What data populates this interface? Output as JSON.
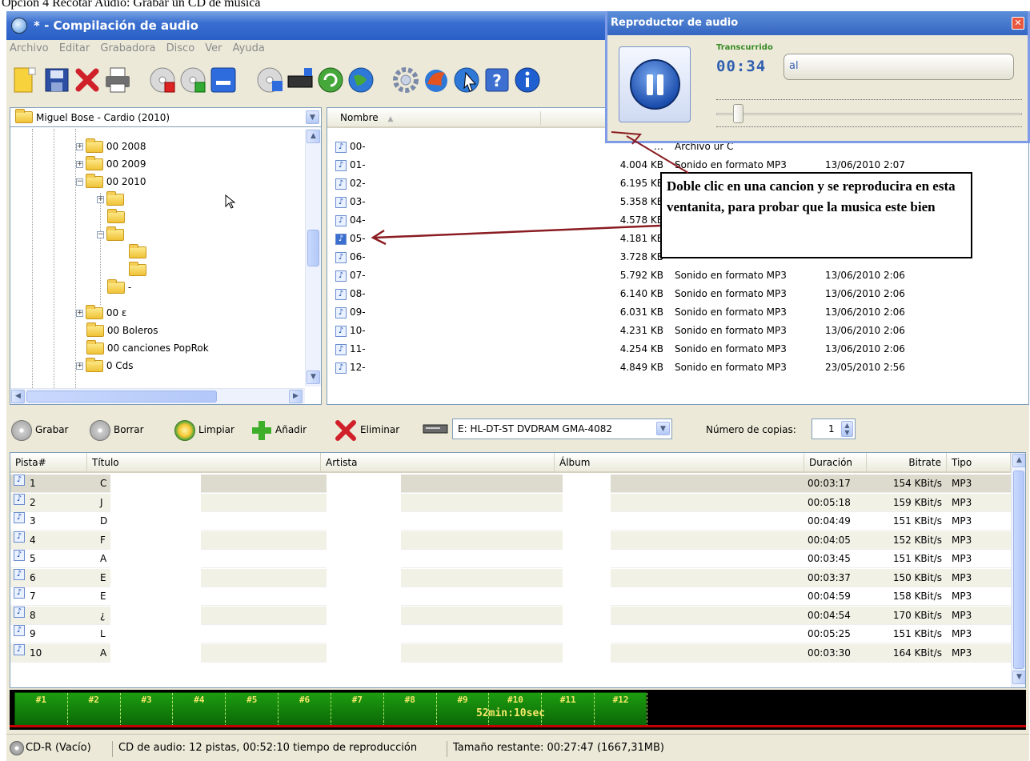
{
  "caption": "Opción 4 Recotar Audio: Grabar un CD de musica",
  "window": {
    "title": "* - Compilación de audio"
  },
  "menu": [
    "Archivo",
    "Editar",
    "Grabadora",
    "Disco",
    "Ver",
    "Ayuda"
  ],
  "folder_combo": "Miguel Bose - Cardio (2010)",
  "tree": {
    "items": [
      {
        "label": "00 2008",
        "expander": "+"
      },
      {
        "label": "00 2009",
        "expander": "+"
      },
      {
        "label": "00 2010",
        "expander": "−"
      },
      {
        "label": "",
        "expander": "+"
      },
      {
        "label": "",
        "expander": ""
      },
      {
        "label": "",
        "expander": "−"
      },
      {
        "label": "",
        "expander": ""
      },
      {
        "label": "",
        "expander": ""
      },
      {
        "label": "-",
        "expander": ""
      },
      {
        "label": "00 ε",
        "expander": "+"
      },
      {
        "label": "00 Boleros",
        "expander": ""
      },
      {
        "label": "00 canciones PopRok",
        "expander": ""
      },
      {
        "label": "0 Cds",
        "expander": "+"
      }
    ]
  },
  "files": {
    "header_name": "Nombre",
    "rows": [
      {
        "name": "00-",
        "size": "…",
        "type": "Archivo ur C",
        "date": ""
      },
      {
        "name": "01-",
        "size": "4.004 KB",
        "type": "Sonido en formato MP3",
        "date": "13/06/2010 2:07"
      },
      {
        "name": "02-",
        "size": "6.195 KB",
        "type": "",
        "date": ""
      },
      {
        "name": "03-",
        "size": "5.358 KB",
        "type": "",
        "date": ""
      },
      {
        "name": "04-",
        "size": "4.578 KB",
        "type": "",
        "date": ""
      },
      {
        "name": "05-",
        "size": "4.181 KB",
        "type": "",
        "date": ""
      },
      {
        "name": "06-",
        "size": "3.728 KB",
        "type": "",
        "date": ""
      },
      {
        "name": "07-",
        "size": "5.792 KB",
        "type": "Sonido en formato MP3",
        "date": "13/06/2010 2:06"
      },
      {
        "name": "08-",
        "size": "6.140 KB",
        "type": "Sonido en formato MP3",
        "date": "13/06/2010 2:06"
      },
      {
        "name": "09-",
        "size": "6.031 KB",
        "type": "Sonido en formato MP3",
        "date": "13/06/2010 2:06"
      },
      {
        "name": "10-",
        "size": "4.231 KB",
        "type": "Sonido en formato MP3",
        "date": "13/06/2010 2:06"
      },
      {
        "name": "11-",
        "size": "4.254 KB",
        "type": "Sonido en formato MP3",
        "date": "13/06/2010 2:06"
      },
      {
        "name": "12-",
        "size": "4.849 KB",
        "type": "Sonido en formato MP3",
        "date": "23/05/2010 2:56"
      }
    ]
  },
  "annotation": "Doble clic en una cancion y se reproducira en esta ventanita, para probar que la musica este bien",
  "player": {
    "title": "Reproductor de audio",
    "elapsed_label": "Transcurrido",
    "time": "00:34",
    "track_field": "al",
    "position_fraction": 0.07
  },
  "burn_bar": {
    "grabar": "Grabar",
    "borrar": "Borrar",
    "limpiar": "Limpiar",
    "anadir": "Añadir",
    "eliminar": "Eliminar",
    "drive": "E: HL-DT-ST DVDRAM GMA-4082",
    "copies_label": "Número de copias:",
    "copies": "1"
  },
  "tracks": {
    "columns": [
      "Pista#",
      "Título",
      "Artista",
      "Álbum",
      "Duración",
      "Bitrate",
      "Tipo"
    ],
    "rows": [
      {
        "n": "1",
        "t": "C",
        "d": "00:03:17",
        "b": "154 KBit/s",
        "ty": "MP3"
      },
      {
        "n": "2",
        "t": "J",
        "d": "00:05:18",
        "b": "159 KBit/s",
        "ty": "MP3"
      },
      {
        "n": "3",
        "t": "D",
        "d": "00:04:49",
        "b": "151 KBit/s",
        "ty": "MP3"
      },
      {
        "n": "4",
        "t": "F",
        "d": "00:04:05",
        "b": "152 KBit/s",
        "ty": "MP3"
      },
      {
        "n": "5",
        "t": "A",
        "d": "00:03:45",
        "b": "151 KBit/s",
        "ty": "MP3"
      },
      {
        "n": "6",
        "t": "E",
        "d": "00:03:37",
        "b": "150 KBit/s",
        "ty": "MP3"
      },
      {
        "n": "7",
        "t": "E",
        "d": "00:04:59",
        "b": "158 KBit/s",
        "ty": "MP3"
      },
      {
        "n": "8",
        "t": "¿",
        "d": "00:04:54",
        "b": "170 KBit/s",
        "ty": "MP3"
      },
      {
        "n": "9",
        "t": "L",
        "d": "00:05:25",
        "b": "151 KBit/s",
        "ty": "MP3"
      },
      {
        "n": "10",
        "t": "A",
        "d": "00:03:30",
        "b": "164 KBit/s",
        "ty": "MP3"
      }
    ]
  },
  "timeline": {
    "markers": [
      "#1",
      "#2",
      "#3",
      "#4",
      "#5",
      "#6",
      "#7",
      "#8",
      "#9",
      "#10",
      "#11",
      "#12"
    ],
    "total": "52min:10sec"
  },
  "status": {
    "disc": "CD-R (Vacío)",
    "info": "CD de audio: 12 pistas, 00:52:10 tiempo de reproducción",
    "remaining": "Tamaño restante: 00:27:47 (1667,31MB)"
  }
}
